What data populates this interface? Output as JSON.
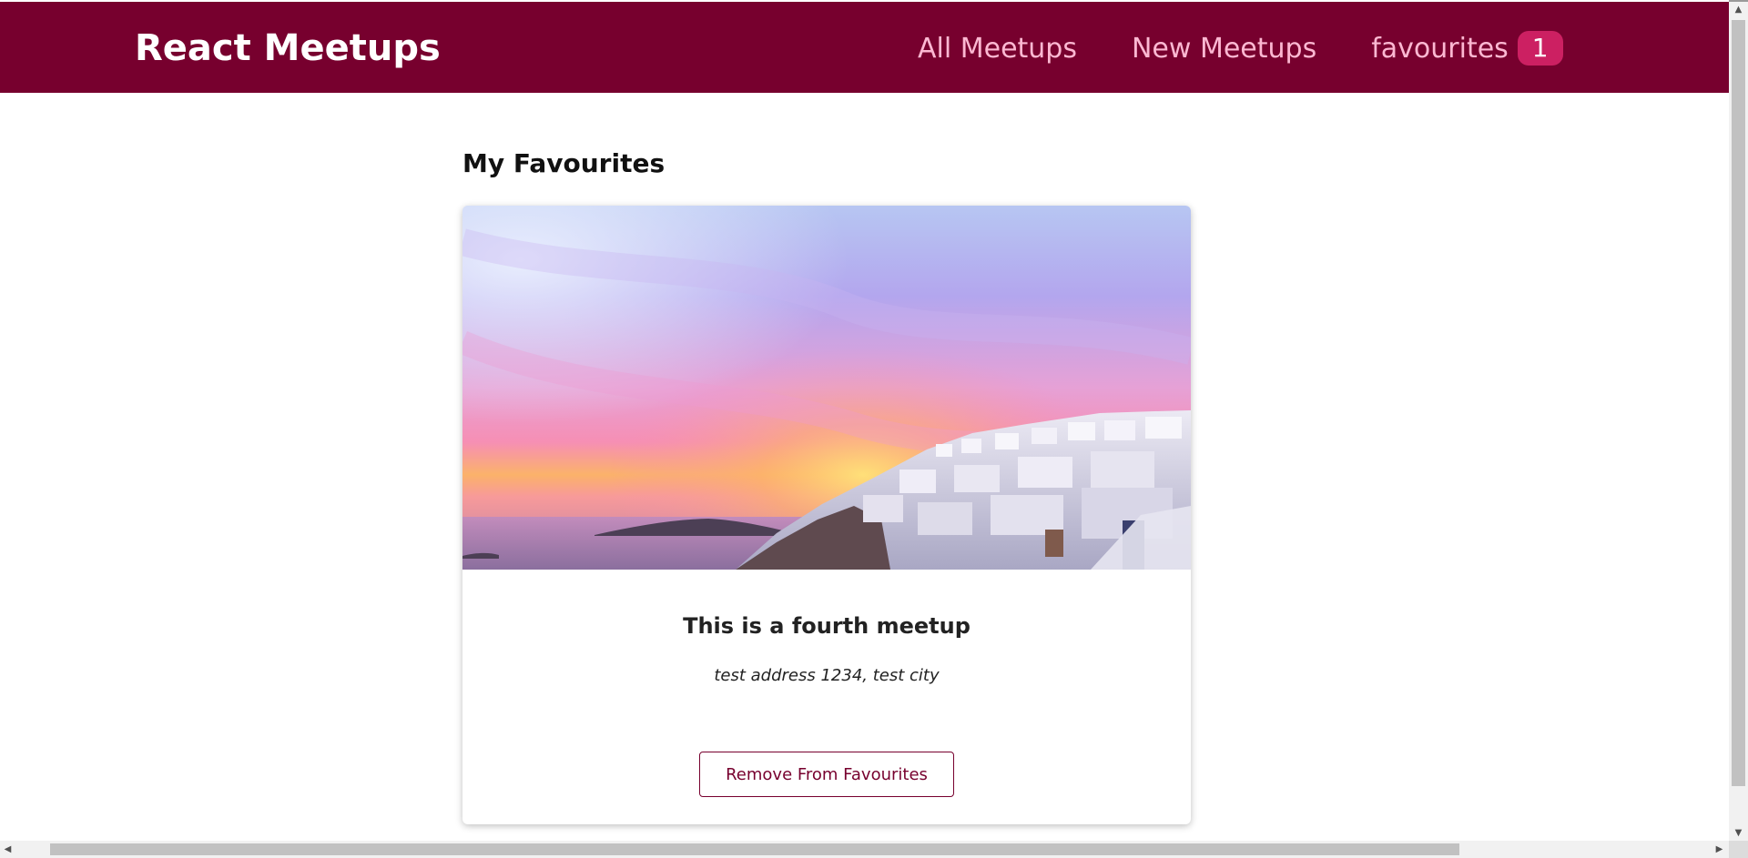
{
  "navbar": {
    "logo": "React Meetups",
    "links": {
      "all_meetups": "All Meetups",
      "new_meetups": "New Meetups",
      "favourites": "favourites"
    },
    "favourites_count": "1"
  },
  "main": {
    "title": "My Favourites",
    "meetup": {
      "image_alt": "Santorini sunset",
      "title": "This is a fourth meetup",
      "address": "test address 1234, test city",
      "action_label": "Remove From Favourites"
    }
  },
  "colors": {
    "navbar_bg": "#77002e",
    "nav_link": "#fcb8d2",
    "badge_bg": "#cc2062",
    "button_accent": "#77002e"
  },
  "icons": {
    "scroll_up": "scroll-up-arrow-icon",
    "scroll_down": "scroll-down-arrow-icon",
    "scroll_left": "scroll-left-arrow-icon",
    "scroll_right": "scroll-right-arrow-icon"
  }
}
